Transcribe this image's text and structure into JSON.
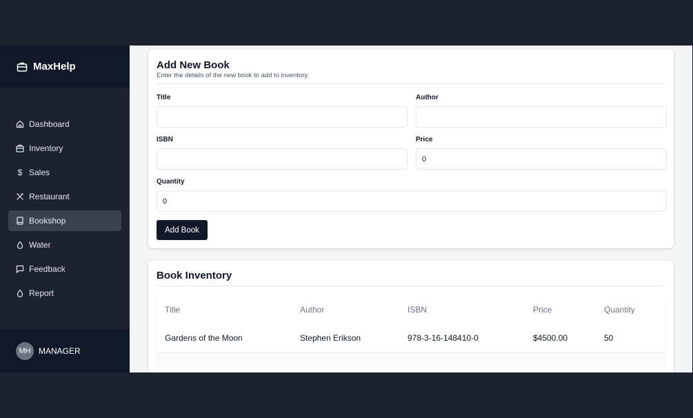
{
  "app": {
    "name": "MaxHelp",
    "brand_icon": "briefcase-icon"
  },
  "sidebar": {
    "items": [
      {
        "label": "Dashboard",
        "icon": "home-icon"
      },
      {
        "label": "Inventory",
        "icon": "briefcase-icon"
      },
      {
        "label": "Sales",
        "icon": "dollar-icon"
      },
      {
        "label": "Restaurant",
        "icon": "utensils-icon"
      },
      {
        "label": "Bookshop",
        "icon": "book-icon",
        "active": true
      },
      {
        "label": "Water",
        "icon": "droplet-icon"
      },
      {
        "label": "Feedback",
        "icon": "message-icon"
      },
      {
        "label": "Report",
        "icon": "droplet-icon"
      }
    ]
  },
  "user": {
    "initials": "MH",
    "role": "MANAGER"
  },
  "form": {
    "title": "Add New Book",
    "description": "Enter the details of the new book to add to inventory.",
    "title_label": "Title",
    "title_value": "",
    "author_label": "Author",
    "author_value": "",
    "isbn_label": "ISBN",
    "isbn_value": "",
    "price_label": "Price",
    "price_value": "0",
    "quantity_label": "Quantity",
    "quantity_value": "0",
    "submit_label": "Add Book"
  },
  "inventory": {
    "title": "Book Inventory",
    "columns": [
      "Title",
      "Author",
      "ISBN",
      "Price",
      "Quantity"
    ],
    "rows": [
      [
        "Gardens of the Moon",
        "Stephen Erikson",
        "978-3-16-148410-0",
        "$4500.00",
        "50"
      ]
    ]
  },
  "colors": {
    "sidebar_bg": "#1c2230",
    "accent_dark": "#111827",
    "active_item": "#3a414f"
  }
}
